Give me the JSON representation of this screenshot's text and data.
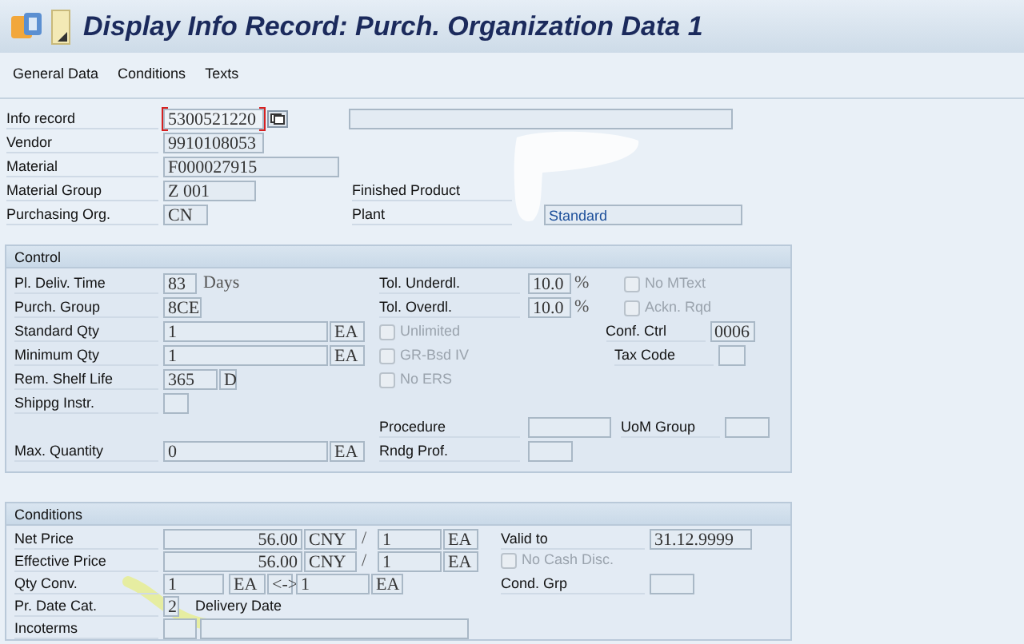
{
  "window": {
    "title": "Display Info Record: Purch. Organization Data 1"
  },
  "tabs": [
    {
      "label": "General Data"
    },
    {
      "label": "Conditions"
    },
    {
      "label": "Texts"
    }
  ],
  "header": {
    "rows": [
      {
        "left": [
          {
            "kind": "label",
            "text": "Info record"
          },
          {
            "kind": "field",
            "value": "5300521220",
            "focused": true
          },
          {
            "kind": "help"
          }
        ],
        "middle": [
          {
            "kind": "field"
          }
        ]
      },
      {
        "left": [
          {
            "kind": "label",
            "text": "Vendor"
          },
          {
            "kind": "field",
            "value": "9910108053"
          }
        ]
      },
      {
        "left": [
          {
            "kind": "label",
            "text": "Material"
          },
          {
            "kind": "field",
            "value": "F000027915"
          }
        ]
      },
      {
        "left": [
          {
            "kind": "label",
            "text": "Material Group"
          },
          {
            "kind": "field",
            "value": "Z   001"
          }
        ],
        "middle": [
          {
            "kind": "label",
            "text": "Finished Product"
          }
        ]
      },
      {
        "left": [
          {
            "kind": "label",
            "text": "Purchasing Org."
          },
          {
            "kind": "field",
            "value": "CN"
          }
        ],
        "middle": [
          {
            "kind": "label",
            "text": "Plant"
          },
          {
            "kind": "field",
            "value": "Standard"
          }
        ]
      }
    ]
  },
  "sections": [
    {
      "title": "Control",
      "rows": [
        {
          "left": [
            {
              "kind": "label",
              "text": "Pl. Deliv. Time"
            },
            {
              "kind": "field",
              "value": "83"
            },
            {
              "kind": "text",
              "text": "Days"
            }
          ],
          "middle": [
            {
              "kind": "label",
              "text": "Tol. Underdl."
            },
            {
              "kind": "field",
              "value": "10.0"
            },
            {
              "kind": "text",
              "text": "%"
            }
          ],
          "right": [
            {
              "kind": "checkbox",
              "label": "No MText",
              "checked": false,
              "disabled": true
            }
          ]
        },
        {
          "left": [
            {
              "kind": "label",
              "text": "Purch. Group"
            },
            {
              "kind": "field",
              "value": "8CE"
            }
          ],
          "middle": [
            {
              "kind": "label",
              "text": "Tol. Overdl."
            },
            {
              "kind": "field",
              "value": "10.0"
            },
            {
              "kind": "text",
              "text": "%"
            }
          ],
          "right": [
            {
              "kind": "checkbox",
              "label": "Ackn. Rqd",
              "checked": false,
              "disabled": true
            }
          ]
        },
        {
          "left": [
            {
              "kind": "label",
              "text": "Standard Qty"
            },
            {
              "kind": "field",
              "value": "1"
            },
            {
              "kind": "field",
              "value": "EA"
            }
          ],
          "middle": [
            {
              "kind": "checkbox",
              "label": "Unlimited",
              "checked": false,
              "disabled": true
            }
          ],
          "right": [
            {
              "kind": "label",
              "text": "Conf. Ctrl"
            },
            {
              "kind": "field",
              "value": "0006"
            }
          ]
        },
        {
          "left": [
            {
              "kind": "label",
              "text": "Minimum Qty"
            },
            {
              "kind": "field",
              "value": "1"
            },
            {
              "kind": "field",
              "value": "EA"
            }
          ],
          "middle": [
            {
              "kind": "checkbox",
              "label": "GR-Bsd IV",
              "checked": false,
              "disabled": true
            }
          ],
          "right": [
            {
              "kind": "label",
              "text": "Tax Code"
            },
            {
              "kind": "field"
            }
          ]
        },
        {
          "left": [
            {
              "kind": "label",
              "text": "Rem. Shelf Life"
            },
            {
              "kind": "field",
              "value": "365"
            },
            {
              "kind": "field",
              "value": "D"
            }
          ],
          "middle": [
            {
              "kind": "checkbox",
              "label": "No ERS",
              "checked": false,
              "disabled": true
            }
          ]
        },
        {
          "left": [
            {
              "kind": "label",
              "text": "Shippg Instr."
            },
            {
              "kind": "field"
            }
          ]
        },
        {
          "middle": [
            {
              "kind": "label",
              "text": "Procedure"
            },
            {
              "kind": "field"
            }
          ],
          "right": [
            {
              "kind": "label",
              "text": "UoM Group"
            },
            {
              "kind": "field"
            }
          ]
        },
        {
          "left": [
            {
              "kind": "label",
              "text": "Max. Quantity"
            },
            {
              "kind": "field",
              "value": "0"
            },
            {
              "kind": "field",
              "value": "EA"
            }
          ],
          "middle": [
            {
              "kind": "label",
              "text": "Rndg Prof."
            },
            {
              "kind": "field"
            }
          ]
        }
      ]
    },
    {
      "title": "Conditions",
      "rows": [
        {
          "left": [
            {
              "kind": "label",
              "text": "Net Price"
            },
            {
              "kind": "field",
              "value": "56.00"
            },
            {
              "kind": "field",
              "value": "CNY"
            },
            {
              "kind": "text",
              "text": "/"
            },
            {
              "kind": "field",
              "value": "1"
            },
            {
              "kind": "field",
              "value": "EA"
            }
          ],
          "right": [
            {
              "kind": "label",
              "text": "Valid to"
            },
            {
              "kind": "field",
              "value": "31.12.9999"
            }
          ]
        },
        {
          "left": [
            {
              "kind": "label",
              "text": "Effective Price"
            },
            {
              "kind": "field",
              "value": "56.00"
            },
            {
              "kind": "field",
              "value": "CNY"
            },
            {
              "kind": "text",
              "text": "/"
            },
            {
              "kind": "field",
              "value": "1"
            },
            {
              "kind": "field",
              "value": "EA"
            }
          ],
          "right": [
            {
              "kind": "checkbox",
              "label": "No Cash Disc.",
              "checked": false,
              "disabled": true
            }
          ]
        },
        {
          "left": [
            {
              "kind": "label",
              "text": "Qty Conv."
            },
            {
              "kind": "field",
              "value": "1"
            },
            {
              "kind": "field",
              "value": "EA"
            },
            {
              "kind": "field",
              "value": "<->"
            },
            {
              "kind": "field",
              "value": "1"
            },
            {
              "kind": "field",
              "value": "EA"
            }
          ],
          "right": [
            {
              "kind": "label",
              "text": "Cond. Grp"
            },
            {
              "kind": "field"
            }
          ]
        },
        {
          "left": [
            {
              "kind": "label",
              "text": "Pr. Date Cat."
            },
            {
              "kind": "field",
              "value": "2"
            },
            {
              "kind": "text",
              "text": "Delivery Date"
            }
          ]
        },
        {
          "left": [
            {
              "kind": "label",
              "text": "Incoterms"
            },
            {
              "kind": "field"
            },
            {
              "kind": "field"
            }
          ]
        }
      ]
    }
  ]
}
